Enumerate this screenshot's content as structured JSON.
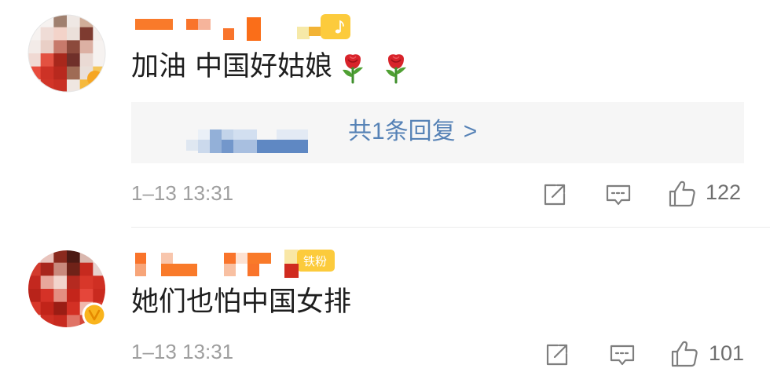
{
  "colors": {
    "text": "#1e1e1e",
    "meta": "#9e9e9e",
    "link": "#5682b6",
    "reply_bg": "#f6f6f6",
    "icon_gray": "#7e7e7e",
    "username_orange": "#f97a2a",
    "badge_yellow": "#fccb3c",
    "verified_yellow": "#f9b41d"
  },
  "comments": [
    {
      "badge": {
        "icon": "music-note-icon"
      },
      "text": "加油 中国好姑娘",
      "emoji": [
        "rose-icon",
        "rose-icon"
      ],
      "replies": {
        "label": "共1条回复",
        "chevron": ">"
      },
      "time": "1–13 13:31",
      "actions": {
        "share": "share-icon",
        "comment": "comment-icon",
        "like": "thumbs-up-icon",
        "like_count": "122"
      }
    },
    {
      "badge": {
        "label": "铁粉"
      },
      "verified": "verified-v-icon",
      "text": "她们也怕中国女排",
      "time": "1–13 13:31",
      "actions": {
        "share": "share-icon",
        "comment": "comment-icon",
        "like": "thumbs-up-icon",
        "like_count": "101"
      }
    }
  ]
}
